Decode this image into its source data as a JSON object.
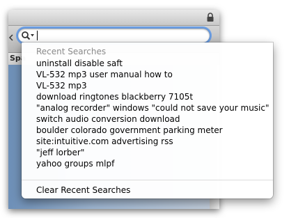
{
  "toolbar": {
    "bookmark_partial": "Spa"
  },
  "search": {
    "value": "",
    "placeholder": ""
  },
  "recent_searches": {
    "header": "Recent Searches",
    "items": [
      "uninstall disable saft",
      "VL-532 mp3 user manual how to",
      "VL-532 mp3",
      "download ringtones blackberry 7105t",
      "\"analog recorder\" windows \"could not save your music\"",
      "switch audio conversion download",
      "boulder colorado government parking meter",
      "site:intuitive.com advertising rss",
      "\"jeff lorber\"",
      "yahoo groups mlpf"
    ],
    "clear_label": "Clear Recent Searches"
  },
  "icons": {
    "lock": "lock-icon",
    "search": "magnifier-dropdown-icon",
    "nav": "chevron-left-icon"
  },
  "colors": {
    "focus_ring": "#5c96e6",
    "header_text": "#8a8a8a"
  }
}
